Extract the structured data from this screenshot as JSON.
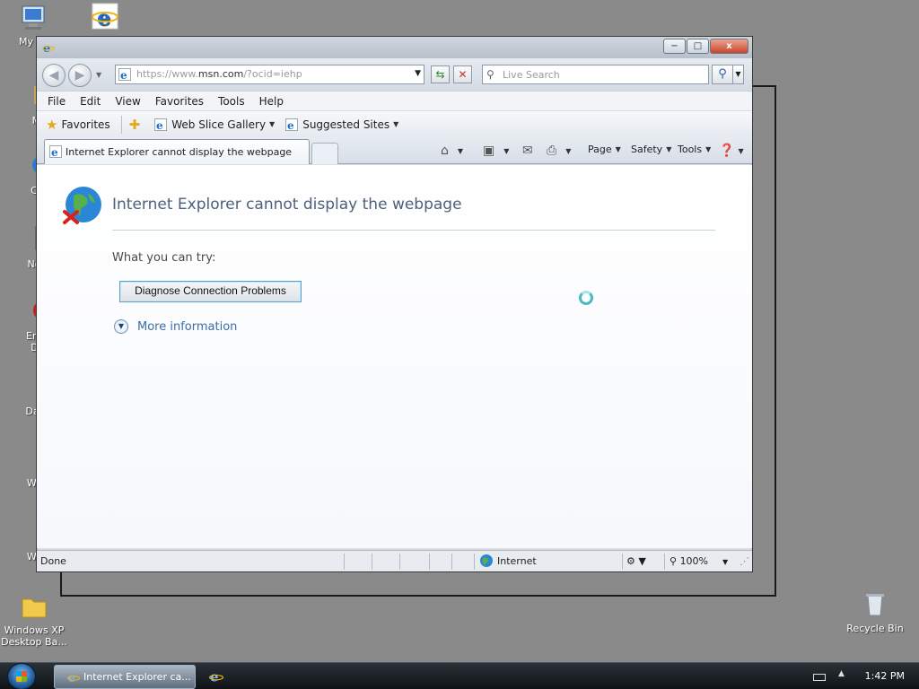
{
  "desktop": {
    "icons": [
      {
        "label": "My Co"
      },
      {
        "label": "MyP"
      },
      {
        "label": "Chro"
      },
      {
        "label": "Notep"
      },
      {
        "label": "Embar Dev-"
      },
      {
        "label": "DataW"
      },
      {
        "label": "Windo"
      },
      {
        "label": "Windo"
      },
      {
        "label": "Windows XP Desktop Ba..."
      },
      {
        "label": "Recycle Bin"
      }
    ]
  },
  "browser": {
    "title_bar": {
      "minimize": "−",
      "maximize": "□",
      "close": "x"
    },
    "address": {
      "prefix": "https://www.",
      "domain": "msn.com",
      "suffix": "/?ocid=iehp"
    },
    "search": {
      "placeholder": "Live Search"
    },
    "menu": [
      "File",
      "Edit",
      "View",
      "Favorites",
      "Tools",
      "Help"
    ],
    "favorites_bar": {
      "favorites": "Favorites",
      "web_slice": "Web Slice Gallery",
      "suggested": "Suggested Sites"
    },
    "tab": {
      "title": "Internet Explorer cannot display the webpage"
    },
    "commands": {
      "page": "Page",
      "safety": "Safety",
      "tools": "Tools"
    },
    "content": {
      "heading": "Internet Explorer cannot display the webpage",
      "try_text": "What you can try:",
      "diagnose_button": "Diagnose Connection Problems",
      "more_info": "More information"
    },
    "status": {
      "text": "Done",
      "zone": "Internet",
      "zoom": "100%"
    }
  },
  "taskbar": {
    "task_label": "Internet Explorer ca...",
    "clock": "1:42 PM"
  },
  "colors": {
    "accent": "#3a6ea8",
    "heading": "#4c5f7c",
    "button_border": "#5a9fc8"
  }
}
